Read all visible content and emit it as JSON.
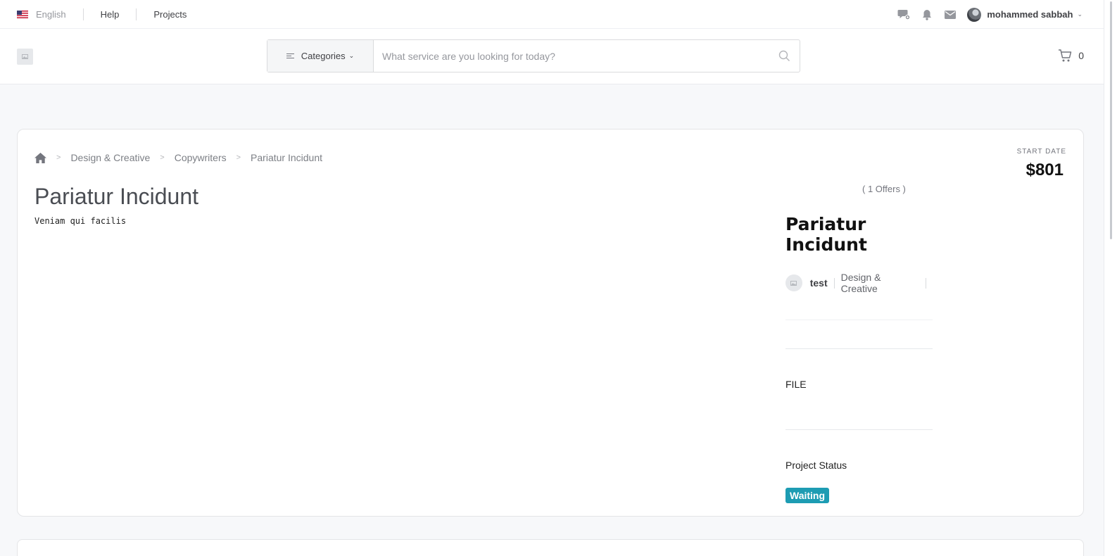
{
  "topbar": {
    "language": "English",
    "links": [
      "Help",
      "Projects"
    ],
    "icons": [
      "chat-icon",
      "bell-icon",
      "mail-icon"
    ],
    "username": "mohammed sabbah"
  },
  "header": {
    "categories_label": "Categories",
    "search_placeholder": "What service are you looking for today?",
    "cart_count": "0"
  },
  "project": {
    "breadcrumb": [
      "Design & Creative",
      "Copywriters",
      "Pariatur Incidunt"
    ],
    "title": "Pariatur Incidunt",
    "description": "Veniam qui facilis",
    "start_date_label": "START DATE",
    "price": "$801",
    "offers": "( 1 Offers )",
    "side_title": "Pariatur Incidunt",
    "owner": "test",
    "category": "Design & Creative",
    "file_label": "FILE",
    "status_label": "Project Status",
    "status": "Waiting"
  },
  "colors": {
    "status_badge": "#1d9cb3",
    "background": "#f7f8fa"
  }
}
